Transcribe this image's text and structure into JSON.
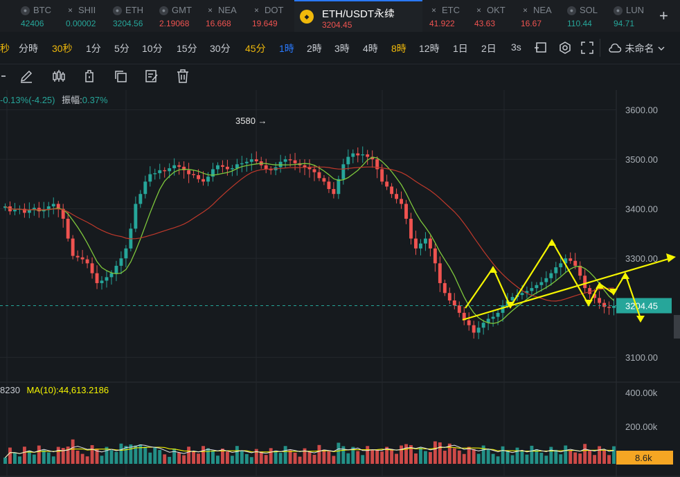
{
  "tabs": [
    {
      "symbol": "BTC",
      "price": "42406",
      "color": "#26a69a",
      "icon": "coin-icon",
      "active": false
    },
    {
      "symbol": "SHII",
      "price": "0.00002",
      "color": "#26a69a",
      "icon": "cross-icon",
      "active": false
    },
    {
      "symbol": "ETH",
      "price": "3204.56",
      "color": "#26a69a",
      "icon": "coin-icon",
      "active": false
    },
    {
      "symbol": "GMT",
      "price": "2.19068",
      "color": "#ef5350",
      "icon": "coin-icon",
      "active": false
    },
    {
      "symbol": "NEA",
      "price": "16.668",
      "color": "#ef5350",
      "icon": "cross-icon",
      "active": false
    },
    {
      "symbol": "DOT",
      "price": "19.649",
      "color": "#ef5350",
      "icon": "cross-icon",
      "active": false
    },
    {
      "symbol": "ETH/USDT永续",
      "price": "3204.45",
      "color": "#ef5350",
      "icon": "binance-icon",
      "active": true
    },
    {
      "symbol": "ETC",
      "price": "41.922",
      "color": "#ef5350",
      "icon": "cross-icon",
      "active": false
    },
    {
      "symbol": "OKT",
      "price": "43.63",
      "color": "#ef5350",
      "icon": "cross-icon",
      "active": false
    },
    {
      "symbol": "NEA",
      "price": "16.67",
      "color": "#ef5350",
      "icon": "cross-icon",
      "active": false
    },
    {
      "symbol": "SOL",
      "price": "110.44",
      "color": "#26a69a",
      "icon": "coin-icon",
      "active": false
    },
    {
      "symbol": "LUN",
      "price": "94.71",
      "color": "#26a69a",
      "icon": "coin-icon",
      "active": false
    }
  ],
  "intervals": [
    {
      "label": "秒",
      "color": "#f0b90b"
    },
    {
      "label": "分時",
      "color": "#c8ccd2"
    },
    {
      "label": "30秒",
      "color": "#f0b90b"
    },
    {
      "label": "1分",
      "color": "#c8ccd2"
    },
    {
      "label": "5分",
      "color": "#c8ccd2"
    },
    {
      "label": "10分",
      "color": "#c8ccd2"
    },
    {
      "label": "15分",
      "color": "#c8ccd2"
    },
    {
      "label": "30分",
      "color": "#c8ccd2"
    },
    {
      "label": "45分",
      "color": "#f0b90b"
    },
    {
      "label": "1時",
      "color": "#2979ff"
    },
    {
      "label": "2時",
      "color": "#c8ccd2"
    },
    {
      "label": "3時",
      "color": "#c8ccd2"
    },
    {
      "label": "4時",
      "color": "#c8ccd2"
    },
    {
      "label": "8時",
      "color": "#f0b90b"
    },
    {
      "label": "12時",
      "color": "#c8ccd2"
    },
    {
      "label": "1日",
      "color": "#c8ccd2"
    },
    {
      "label": "2日",
      "color": "#c8ccd2"
    },
    {
      "label": "3s",
      "color": "#c8ccd2"
    }
  ],
  "toolbar": {
    "layout_name": "未命名"
  },
  "info": {
    "change": "-0.13%(-4.25)",
    "amplitude_label": "振幅:",
    "amplitude": "0.37%"
  },
  "volume_info": {
    "prefix": "8230",
    "ma_label": "MA(10):44,613.2186"
  },
  "price_axis": [
    "3600.00",
    "3500.00",
    "3400.00",
    "3300.00",
    "3100.00"
  ],
  "current_price": "3204.45",
  "volume_axis": [
    "400.00k",
    "200.00k"
  ],
  "current_volume": "8.6k",
  "high_marker": "3580 →",
  "chart_data": {
    "type": "candlestick",
    "y_range": [
      3050,
      3640
    ],
    "y_ticks": [
      3600,
      3500,
      3400,
      3300,
      3100
    ],
    "high_label": 3580,
    "current_price": 3204.45,
    "closes": [
      3405,
      3395,
      3398,
      3400,
      3392,
      3398,
      3402,
      3395,
      3398,
      3405,
      3410,
      3400,
      3380,
      3340,
      3305,
      3302,
      3298,
      3290,
      3270,
      3250,
      3255,
      3262,
      3270,
      3285,
      3300,
      3320,
      3360,
      3410,
      3430,
      3455,
      3470,
      3472,
      3478,
      3476,
      3482,
      3488,
      3485,
      3478,
      3470,
      3468,
      3460,
      3455,
      3465,
      3480,
      3488,
      3485,
      3480,
      3482,
      3490,
      3492,
      3495,
      3500,
      3496,
      3488,
      3480,
      3478,
      3484,
      3495,
      3500,
      3498,
      3492,
      3488,
      3484,
      3480,
      3474,
      3462,
      3455,
      3440,
      3430,
      3460,
      3490,
      3505,
      3512,
      3508,
      3510,
      3505,
      3500,
      3480,
      3455,
      3445,
      3430,
      3420,
      3410,
      3380,
      3340,
      3320,
      3330,
      3340,
      3320,
      3290,
      3250,
      3230,
      3215,
      3205,
      3190,
      3175,
      3165,
      3150,
      3160,
      3170,
      3178,
      3182,
      3190,
      3205,
      3215,
      3222,
      3226,
      3230,
      3234,
      3240,
      3246,
      3252,
      3260,
      3270,
      3282,
      3290,
      3300,
      3295,
      3285,
      3265,
      3240,
      3228,
      3220,
      3210,
      3202,
      3200,
      3204
    ],
    "volume_ma_label": "MA(10):44,613.2186"
  },
  "colors": {
    "up": "#26a69a",
    "down": "#ef5350",
    "ma_fast": "#7ec83c",
    "ma_slow": "#c0392b",
    "annotation": "#f5f500",
    "accent": "#2979ff",
    "price_tag": "#26a69a",
    "volume_tag": "#f5a623"
  }
}
